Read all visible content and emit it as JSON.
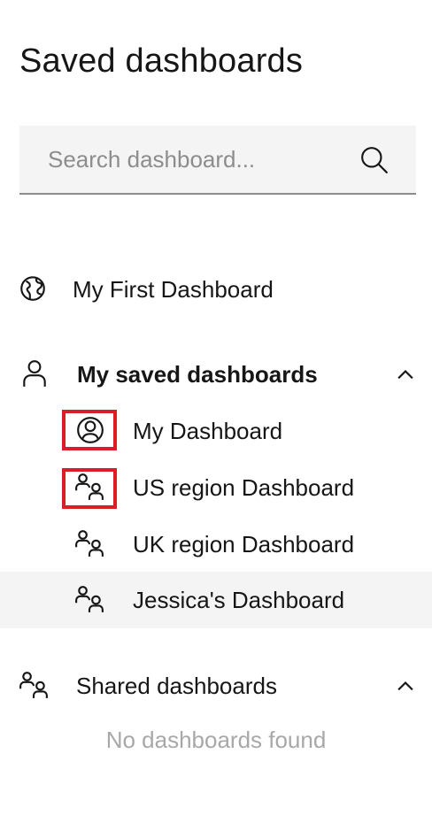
{
  "panel": {
    "title": "Saved dashboards"
  },
  "search": {
    "placeholder": "Search dashboard...",
    "value": "",
    "icon": "search-icon"
  },
  "items": {
    "first": {
      "label": "My First Dashboard",
      "icon": "globe-icon"
    }
  },
  "sections": {
    "my_saved": {
      "label": "My saved dashboards",
      "icon": "user-icon",
      "expanded": true,
      "items": [
        {
          "label": "My Dashboard",
          "icon": "user-avatar-icon",
          "highlighted": true
        },
        {
          "label": "US region Dashboard",
          "icon": "group-icon",
          "highlighted": true
        },
        {
          "label": "UK region Dashboard",
          "icon": "group-icon",
          "highlighted": false
        },
        {
          "label": "Jessica's Dashboard",
          "icon": "group-icon",
          "highlighted": false,
          "hovered": true
        }
      ]
    },
    "shared": {
      "label": "Shared dashboards",
      "icon": "group-icon",
      "expanded": true,
      "empty_text": "No dashboards found"
    }
  },
  "colors": {
    "text": "#161616",
    "placeholder": "#8d8d8d",
    "field_bg": "#f4f4f4",
    "field_border": "#8d8d8d",
    "highlight_box": "#da1e28",
    "hover_bg": "#f4f4f4",
    "empty_text": "#a8a8a8"
  }
}
